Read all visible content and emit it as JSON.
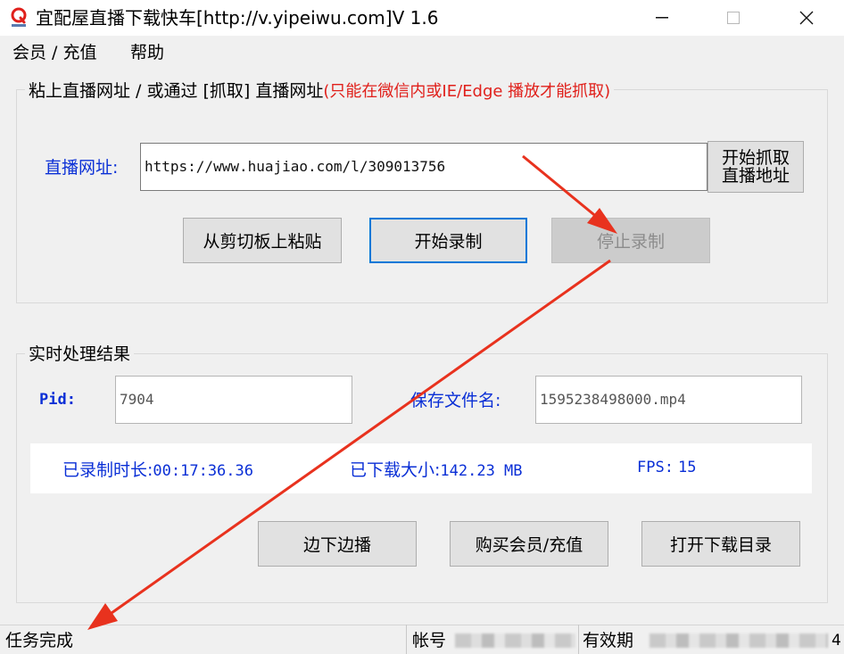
{
  "window": {
    "title": "宜配屋直播下载快车[http://v.yipeiwu.com]V 1.6",
    "minimize_glyph": "—",
    "close_glyph": "✕"
  },
  "menu": {
    "items": [
      {
        "label": "会员 / 充值"
      },
      {
        "label": "帮助"
      }
    ]
  },
  "url_group": {
    "title": "粘上直播网址 / 或通过 [抓取] 直播网址",
    "note": "(只能在微信内或IE/Edge 播放才能抓取)",
    "url_label": "直播网址:",
    "url_value": "https://www.huajiao.com/l/309013756",
    "grab_button_line1": "开始抓取",
    "grab_button_line2": "直播地址",
    "paste_button": "从剪切板上粘贴",
    "start_button": "开始录制",
    "stop_button": "停止录制"
  },
  "result_group": {
    "title": "实时处理结果",
    "pid_label": "Pid:",
    "pid_value": "7904",
    "filename_label": "保存文件名:",
    "filename_value": "1595238498000.mp4",
    "duration_label": "已录制时长:",
    "duration_value": "00:17:36.36",
    "size_label": "已下载大小:",
    "size_value": "142.23 MB",
    "fps_label": "FPS:",
    "fps_value": "15",
    "play_button": "边下边播",
    "buy_button": "购买会员/充值",
    "open_dir_button": "打开下载目录"
  },
  "status": {
    "task": "任务完成",
    "account_label": "帐号",
    "expiry_label": "有效期",
    "end_char": "4"
  },
  "colors": {
    "accent_blue": "#0a2fd6",
    "note_red": "#e0201b",
    "arrow_red": "#e8321e",
    "focus_blue": "#0078d7"
  }
}
